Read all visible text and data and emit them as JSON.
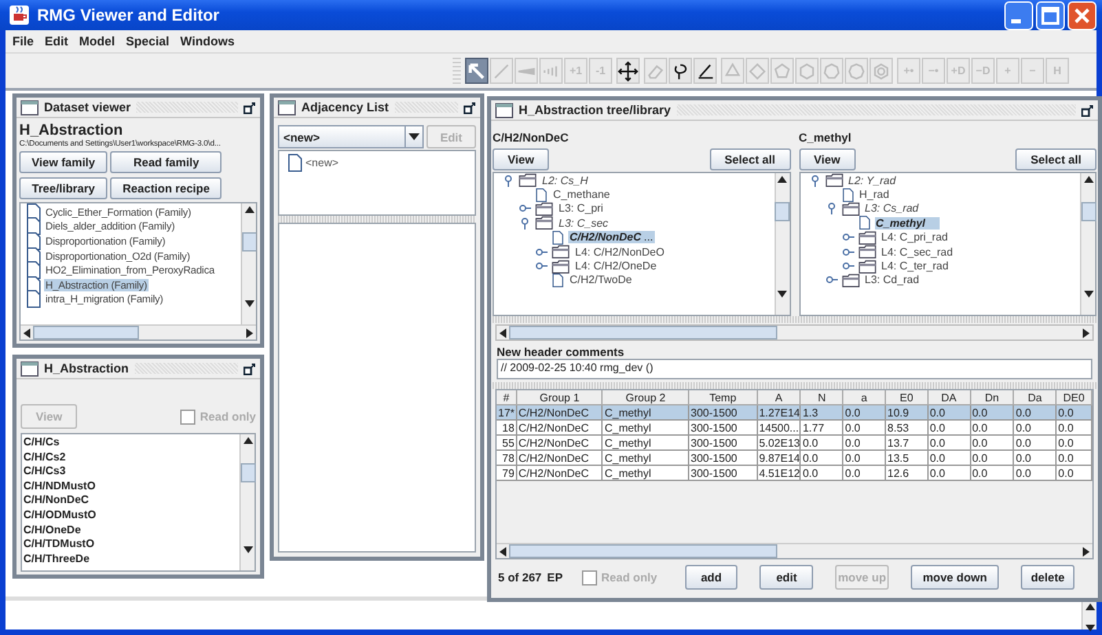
{
  "window": {
    "title": "RMG Viewer and Editor"
  },
  "menu": [
    "File",
    "Edit",
    "Model",
    "Special",
    "Windows"
  ],
  "toolbar": {
    "groups": [
      {
        "buttons": [
          {
            "kind": "pointer",
            "selected": true,
            "disabled": false
          },
          {
            "kind": "line",
            "selected": false,
            "disabled": true
          },
          {
            "kind": "wedge",
            "selected": false,
            "disabled": true
          },
          {
            "kind": "hash",
            "selected": false,
            "disabled": true
          },
          {
            "kind": "text",
            "label": "+1",
            "selected": false,
            "disabled": true
          },
          {
            "kind": "text",
            "label": "-1",
            "selected": false,
            "disabled": true
          }
        ]
      },
      {
        "buttons": [
          {
            "kind": "move",
            "selected": false,
            "disabled": false
          }
        ]
      },
      {
        "buttons": [
          {
            "kind": "eraser",
            "selected": false,
            "disabled": true
          },
          {
            "kind": "lasso",
            "selected": false,
            "disabled": false
          },
          {
            "kind": "pen",
            "selected": false,
            "disabled": false
          }
        ]
      },
      {
        "buttons": [
          {
            "kind": "triangle",
            "selected": false,
            "disabled": true
          },
          {
            "kind": "square",
            "selected": false,
            "disabled": true
          },
          {
            "kind": "pentagon",
            "selected": false,
            "disabled": true
          },
          {
            "kind": "hexagon",
            "selected": false,
            "disabled": true
          },
          {
            "kind": "heptagon",
            "selected": false,
            "disabled": true
          },
          {
            "kind": "octagon",
            "selected": false,
            "disabled": true
          },
          {
            "kind": "ring",
            "selected": false,
            "disabled": true
          }
        ]
      },
      {
        "buttons": [
          {
            "kind": "text",
            "label": "+•",
            "selected": false,
            "disabled": true
          },
          {
            "kind": "text",
            "label": "−•",
            "selected": false,
            "disabled": true
          },
          {
            "kind": "text",
            "label": "+D",
            "selected": false,
            "disabled": true
          },
          {
            "kind": "text",
            "label": "−D",
            "selected": false,
            "disabled": true
          },
          {
            "kind": "text",
            "label": "+",
            "selected": false,
            "disabled": true
          },
          {
            "kind": "text",
            "label": "−",
            "selected": false,
            "disabled": true
          },
          {
            "kind": "text",
            "label": "H",
            "selected": false,
            "disabled": true
          }
        ]
      }
    ]
  },
  "dataset_viewer": {
    "title": "Dataset viewer",
    "heading": "H_Abstraction",
    "path": "C:\\Documents and Settings\\User1\\workspace\\RMG-3.0\\d...",
    "buttons": [
      "View family",
      "Read family",
      "Tree/library",
      "Reaction recipe"
    ],
    "tree": [
      {
        "label": "Cyclic_Ether_Formation (Family)",
        "selected": false
      },
      {
        "label": "Diels_alder_addition (Family)",
        "selected": false
      },
      {
        "label": "Disproportionation (Family)",
        "selected": false
      },
      {
        "label": "Disproportionation_O2d (Family)",
        "selected": false
      },
      {
        "label": "HO2_Elimination_from_PeroxyRadica",
        "selected": false
      },
      {
        "label": "H_Abstraction (Family)",
        "selected": true
      },
      {
        "label": "intra_H_migration (Family)",
        "selected": false
      }
    ]
  },
  "adjacency_list": {
    "title": "Adjacency List",
    "combo_value": "<new>",
    "edit_button": {
      "label": "Edit",
      "disabled": true
    },
    "items": [
      "<new>"
    ]
  },
  "group_list": {
    "title": "H_Abstraction",
    "view_button": {
      "label": "View",
      "disabled": true
    },
    "read_only": {
      "label": "Read only",
      "checked": false,
      "disabled": true
    },
    "items": [
      "C/H/Cs",
      "C/H/Cs2",
      "C/H/Cs3",
      "C/H/NDMustO",
      "C/H/NonDeC",
      "C/H/ODMustO",
      "C/H/OneDe",
      "C/H/TDMustO",
      "C/H/ThreeDe"
    ]
  },
  "tree_library": {
    "title": "H_Abstraction tree/library",
    "panes": [
      {
        "heading": "C/H2/NonDeC",
        "view_label": "View",
        "select_all_label": "Select all",
        "tree": [
          {
            "label": "L2: Cs_H",
            "kind": "folder",
            "expanded": true,
            "selected": false,
            "children": [
              {
                "label": "C_methane",
                "kind": "file",
                "selected": false
              },
              {
                "label": "L3: C_pri",
                "kind": "folder",
                "expanded": false,
                "selected": false
              },
              {
                "label": "L3: C_sec",
                "kind": "folder",
                "expanded": true,
                "selected": false,
                "children": [
                  {
                    "label": "C/H2/NonDeC",
                    "kind": "file",
                    "selected": true,
                    "note": "..."
                  },
                  {
                    "label": "L4: C/H2/NonDeO",
                    "kind": "folder",
                    "expanded": false,
                    "selected": false
                  },
                  {
                    "label": "L4: C/H2/OneDe",
                    "kind": "folder",
                    "expanded": false,
                    "selected": false
                  },
                  {
                    "label": "C/H2/TwoDe",
                    "kind": "file",
                    "selected": false
                  }
                ]
              }
            ]
          }
        ]
      },
      {
        "heading": "C_methyl",
        "view_label": "View",
        "select_all_label": "Select all",
        "tree": [
          {
            "label": "L2: Y_rad",
            "kind": "folder",
            "expanded": true,
            "selected": false,
            "children": [
              {
                "label": "H_rad",
                "kind": "file",
                "selected": false
              },
              {
                "label": "L3: Cs_rad",
                "kind": "folder",
                "expanded": true,
                "selected": false,
                "children": [
                  {
                    "label": "C_methyl",
                    "kind": "file",
                    "selected": true
                  },
                  {
                    "label": "L4: C_pri_rad",
                    "kind": "folder",
                    "expanded": false,
                    "selected": false
                  },
                  {
                    "label": "L4: C_sec_rad",
                    "kind": "folder",
                    "expanded": false,
                    "selected": false
                  },
                  {
                    "label": "L4: C_ter_rad",
                    "kind": "folder",
                    "expanded": false,
                    "selected": false
                  }
                ]
              },
              {
                "label": "L3: Cd_rad",
                "kind": "folder",
                "expanded": false,
                "selected": false
              }
            ]
          }
        ]
      }
    ],
    "comments_label": "New header comments",
    "comments": "// 2009-02-25 10:40 rmg_dev ()",
    "table": {
      "columns": [
        "#",
        "Group 1",
        "Group 2",
        "Temp",
        "A",
        "N",
        "a",
        "E0",
        "DA",
        "Dn",
        "Da",
        "DE0"
      ],
      "rows": [
        {
          "selected": true,
          "cells": [
            "17*",
            "C/H2/NonDeC",
            "C_methyl",
            "300-1500",
            "1.27E14",
            "1.3",
            "0.0",
            "10.9",
            "0.0",
            "0.0",
            "0.0",
            "0.0"
          ]
        },
        {
          "selected": false,
          "cells": [
            "18",
            "C/H2/NonDeC",
            "C_methyl",
            "300-1500",
            "14500...",
            "1.77",
            "0.0",
            "8.53",
            "0.0",
            "0.0",
            "0.0",
            "0.0"
          ]
        },
        {
          "selected": false,
          "cells": [
            "55",
            "C/H2/NonDeC",
            "C_methyl",
            "300-1500",
            "5.02E13",
            "0.0",
            "0.0",
            "13.7",
            "0.0",
            "0.0",
            "0.0",
            "0.0"
          ]
        },
        {
          "selected": false,
          "cells": [
            "78",
            "C/H2/NonDeC",
            "C_methyl",
            "300-1500",
            "9.87E14",
            "0.0",
            "0.0",
            "13.5",
            "0.0",
            "0.0",
            "0.0",
            "0.0"
          ]
        },
        {
          "selected": false,
          "cells": [
            "79",
            "C/H2/NonDeC",
            "C_methyl",
            "300-1500",
            "4.51E12",
            "0.0",
            "0.0",
            "12.6",
            "0.0",
            "0.0",
            "0.0",
            "0.0"
          ]
        }
      ]
    },
    "count": "5 of 267",
    "source": "EP",
    "read_only": {
      "label": "Read only",
      "checked": false,
      "disabled": true
    },
    "buttons": [
      {
        "label": "add",
        "disabled": false
      },
      {
        "label": "edit",
        "disabled": false
      },
      {
        "label": "move up",
        "disabled": true
      },
      {
        "label": "move down",
        "disabled": false
      },
      {
        "label": "delete",
        "disabled": false
      }
    ]
  }
}
